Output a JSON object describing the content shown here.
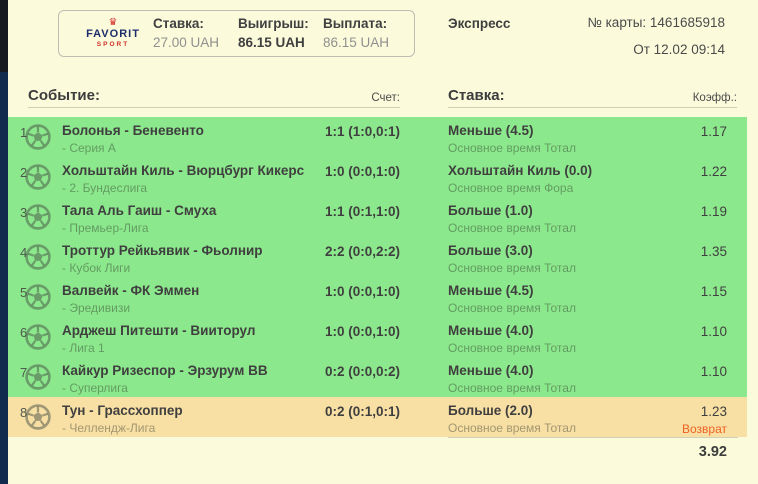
{
  "colors": {
    "background": "#FBFBDC",
    "row_win": "#8CE88C",
    "row_return": "#F8DFA4",
    "return_text": "#EE6223",
    "strip_top": "#16191F",
    "strip_bottom": "#112B4F",
    "logo_navy": "#1D2D6B",
    "logo_red": "#D42B28"
  },
  "header": {
    "logo": {
      "brand": "FAVORIT",
      "sub": "SPORT",
      "crown": "♛"
    },
    "stats": [
      {
        "label": "Ставка:",
        "value": "27.00 UAH"
      },
      {
        "label": "Выигрыш:",
        "value": "86.15 UAH"
      },
      {
        "label": "Выплата:",
        "value": "86.15 UAH"
      }
    ],
    "bet_mode": "Экспресс",
    "card_number": "№ карты: 1461685918",
    "date": "От 12.02 09:14"
  },
  "table": {
    "col_event": "Событие:",
    "col_score": "Счет:",
    "col_bet": "Ставка:",
    "col_coeff": "Коэфф.:",
    "total_coeff": "3.92"
  },
  "rows": [
    {
      "num": "1",
      "event": "Болонья - Беневенто",
      "league": "- Серия А",
      "score": "1:1 (1:0,0:1)",
      "bet": "Меньше (4.5)",
      "bet_type": "Основное время Тотал",
      "coeff": "1.17",
      "note": "",
      "status": "win"
    },
    {
      "num": "2",
      "event": "Хольштайн Киль - Вюрцбург Кикерс",
      "league": "- 2. Бундеслига",
      "score": "1:0 (0:0,1:0)",
      "bet": "Хольштайн Киль (0.0)",
      "bet_type": "Основное время Фора",
      "coeff": "1.22",
      "note": "",
      "status": "win"
    },
    {
      "num": "3",
      "event": "Тала Аль Гаиш - Смуха",
      "league": "- Премьер-Лига",
      "score": "1:1 (0:1,1:0)",
      "bet": "Больше (1.0)",
      "bet_type": "Основное время Тотал",
      "coeff": "1.19",
      "note": "",
      "status": "win"
    },
    {
      "num": "4",
      "event": "Троттур Рейкьявик - Фьолнир",
      "league": "- Кубок Лиги",
      "score": "2:2 (0:0,2:2)",
      "bet": "Больше (3.0)",
      "bet_type": "Основное время Тотал",
      "coeff": "1.35",
      "note": "",
      "status": "win"
    },
    {
      "num": "5",
      "event": "Валвейк - ФК Эммен",
      "league": "- Эредивизи",
      "score": "1:0 (0:0,1:0)",
      "bet": "Меньше (4.5)",
      "bet_type": "Основное время Тотал",
      "coeff": "1.15",
      "note": "",
      "status": "win"
    },
    {
      "num": "6",
      "event": "Арджеш Питешти - Вииторул",
      "league": "- Лига 1",
      "score": "1:0 (0:0,1:0)",
      "bet": "Меньше (4.0)",
      "bet_type": "Основное время Тотал",
      "coeff": "1.10",
      "note": "",
      "status": "win"
    },
    {
      "num": "7",
      "event": "Кайкур Ризеспор - Эрзурум ВВ",
      "league": "- Суперлига",
      "score": "0:2 (0:0,0:2)",
      "bet": "Меньше (4.0)",
      "bet_type": "Основное время Тотал",
      "coeff": "1.10",
      "note": "",
      "status": "win"
    },
    {
      "num": "8",
      "event": "Тун - Грассхоппер",
      "league": "- Челлендж-Лига",
      "score": "0:2 (0:1,0:1)",
      "bet": "Больше (2.0)",
      "bet_type": "Основное время Тотал",
      "coeff": "1.23",
      "note": "Возврат",
      "status": "return"
    }
  ]
}
